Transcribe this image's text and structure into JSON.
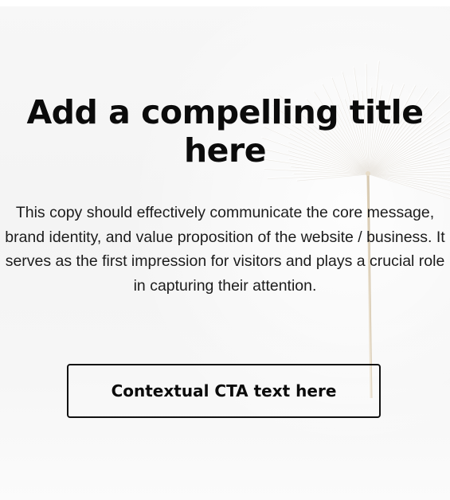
{
  "hero": {
    "title": "Add a compelling title here",
    "body": "This copy should effectively communicate the core message, brand identity, and value proposition of the website / business. It serves as the first impression for visitors and plays a crucial role in capturing their attention.",
    "cta_label": "Contextual CTA text here",
    "background_image": "dandelion-seed-image"
  },
  "colors": {
    "text": "#0b0b0b",
    "background": "#f5f5f5",
    "cta_border": "#111111"
  }
}
